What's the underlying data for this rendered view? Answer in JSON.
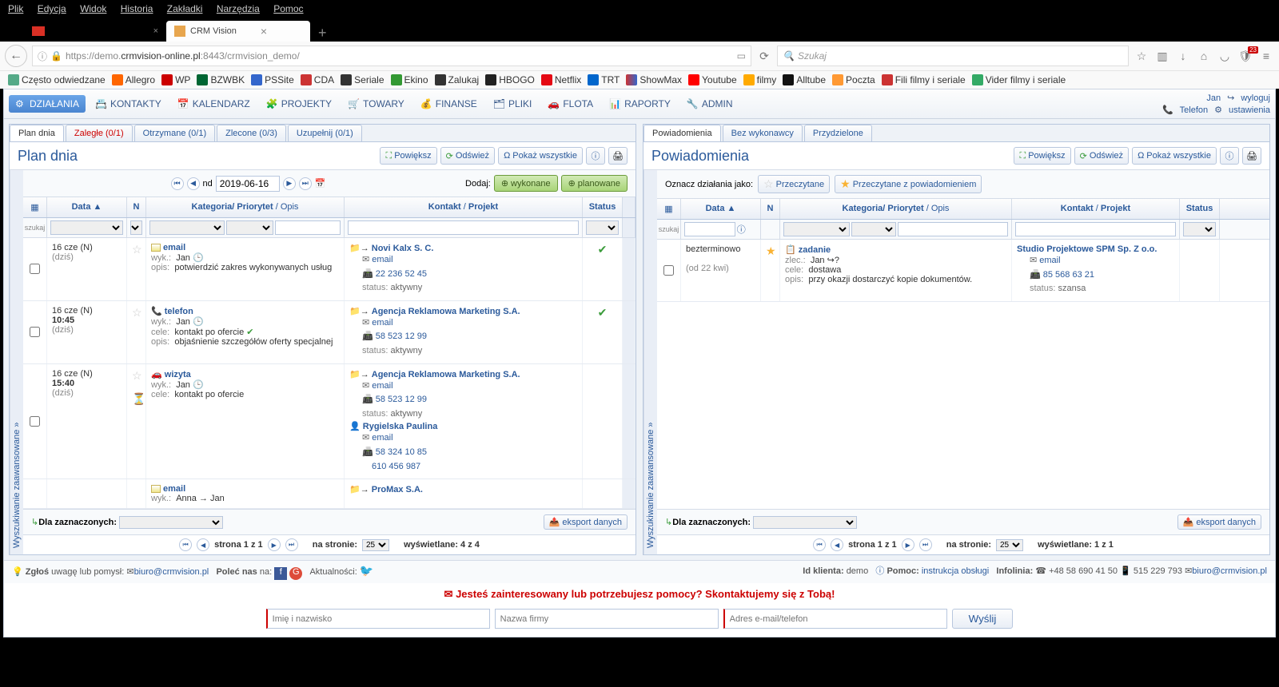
{
  "browser_menu": [
    "Plik",
    "Edycja",
    "Widok",
    "Historia",
    "Zakładki",
    "Narzędzia",
    "Pomoc"
  ],
  "tab_title": "CRM Vision",
  "url_text_1": "https://demo.",
  "url_text_2": "crmvision-online.pl",
  "url_text_3": ":8443/crmvision_demo/",
  "search_placeholder": "Szukaj",
  "shield_badge": "23",
  "bookmarks": [
    "Często odwiedzane",
    "Allegro",
    "WP",
    "BZWBK",
    "PSSite",
    "CDA",
    "Seriale",
    "Ekino",
    "Zalukaj",
    "HBOGO",
    "Netflix",
    "TRT",
    "ShowMax",
    "Youtube",
    "filmy",
    "Alltube",
    "Poczta",
    "Fili filmy i seriale",
    "Vider filmy i seriale"
  ],
  "nav": {
    "items": [
      "DZIAŁANIA",
      "KONTAKTY",
      "KALENDARZ",
      "PROJEKTY",
      "TOWARY",
      "FINANSE",
      "PLIKI",
      "FLOTA",
      "RAPORTY",
      "ADMIN"
    ],
    "user": "Jan",
    "logout": "wyloguj",
    "phone": "Telefon",
    "settings": "ustawienia"
  },
  "left": {
    "tabs": [
      "Plan dnia",
      "Zaległe (0/1)",
      "Otrzymane (0/1)",
      "Zlecone (0/3)",
      "Uzupełnij (0/1)"
    ],
    "title": "Plan dnia",
    "tools": {
      "expand": "Powiększ",
      "refresh": "Odśwież",
      "showall": "Pokaż wszystkie"
    },
    "adv_search": "Wyszukiwanie zaawansowane",
    "date_prefix": "nd",
    "date": "2019-06-16",
    "dodaj": "Dodaj:",
    "wykonane": "wykonane",
    "planowane": "planowane",
    "cols": {
      "date": "Data",
      "n": "N",
      "cat": "Kategoria/ Priorytet",
      "opis": "Opis",
      "kontakt": "Kontakt",
      "projekt": "Projekt",
      "status": "Status"
    },
    "search_lbl": "szukaj",
    "rows": [
      {
        "date": "16 cze (N)",
        "time": "",
        "today": "(dziś)",
        "type": "email",
        "type_ico": "mail",
        "wyk": "Jan",
        "cele": "",
        "opis": "potwierdzić zakres wykonywanych usług",
        "contact": "Novi Kalx S. C.",
        "c_email": "email",
        "c_phone": "22 236 52 45",
        "c_status": "aktywny",
        "status": "✔"
      },
      {
        "date": "16 cze (N)",
        "time": "10:45",
        "today": "(dziś)",
        "type": "telefon",
        "type_ico": "phone",
        "wyk": "Jan",
        "cele": "kontakt po ofercie",
        "cele_check": "✔",
        "opis": "objaśnienie szczegółów oferty specjalnej",
        "contact": "Agencja Reklamowa Marketing S.A.",
        "c_email": "email",
        "c_phone": "58 523 12 99",
        "c_status": "aktywny",
        "status": "✔"
      },
      {
        "date": "16 cze (N)",
        "time": "15:40",
        "today": "(dziś)",
        "type": "wizyta",
        "type_ico": "car",
        "wyk": "Jan",
        "cele": "kontakt po ofercie",
        "opis": "",
        "contact": "Agencja Reklamowa Marketing S.A.",
        "c_email": "email",
        "c_phone": "58 523 12 99",
        "c_status": "aktywny",
        "person": "Rygielska Paulina",
        "p_email": "email",
        "p_phone": "58 324 10 85",
        "p_mobile": "610 456 987",
        "hourglass": true
      },
      {
        "date": "",
        "type": "email",
        "type_ico": "mail",
        "wyk": "Anna",
        "wyk2": "Jan",
        "contact": "ProMax S.A."
      }
    ],
    "for_selected": "Dla zaznaczonych:",
    "export": "eksport danych",
    "pager": {
      "page": "strona 1 z 1",
      "per": "na stronie:",
      "per_val": "25",
      "shown": "wyświetlane: 4 z 4"
    }
  },
  "right": {
    "tabs": [
      "Powiadomienia",
      "Bez wykonawcy",
      "Przydzielone"
    ],
    "title": "Powiadomienia",
    "tools": {
      "expand": "Powiększ",
      "refresh": "Odśwież",
      "showall": "Pokaż wszystkie"
    },
    "mark_label": "Oznacz działania jako:",
    "mark1": "Przeczytane",
    "mark2": "Przeczytane z powiadomieniem",
    "adv_search": "Wyszukiwanie zaawansowane",
    "cols": {
      "date": "Data",
      "n": "N",
      "cat": "Kategoria/ Priorytet",
      "opis": "Opis",
      "kontakt": "Kontakt",
      "projekt": "Projekt",
      "status": "Status"
    },
    "search_lbl": "szukaj",
    "row": {
      "date1": "bezterminowo",
      "date2": "(od 22 kwi)",
      "type": "zadanie",
      "zlec_l": "zlec.:",
      "zlec": "Jan",
      "cele_l": "cele:",
      "cele": "dostawa",
      "opis_l": "opis:",
      "opis": "przy okazji dostarczyć kopie dokumentów.",
      "contact": "Studio Projektowe SPM Sp. Z o.o.",
      "c_email": "email",
      "c_phone": "85 568 63 21",
      "c_status_l": "status:",
      "c_status": "szansa"
    },
    "for_selected": "Dla zaznaczonych:",
    "export": "eksport danych",
    "pager": {
      "page": "strona 1 z 1",
      "per": "na stronie:",
      "per_val": "25",
      "shown": "wyświetlane: 1 z 1"
    }
  },
  "footer": {
    "report": "Zgłoś",
    "report_suffix": "uwagę lub pomysł:",
    "report_email": "biuro@crmvision.pl",
    "recommend": "Poleć nas",
    "recommend_suffix": "na:",
    "news": "Aktualności:",
    "client_l": "Id klienta:",
    "client": "demo",
    "help_l": "Pomoc:",
    "help": "instrukcja obsługi",
    "hotline_l": "Infolinia:",
    "hotline1": "+48 58 690 41 50",
    "hotline2": "515 229 793",
    "email": "biuro@crmvision.pl"
  },
  "cta": "Jesteś zainteresowany lub potrzebujesz pomocy? Skontaktujemy się z Tobą!",
  "form": {
    "name": "Imię i nazwisko",
    "company": "Nazwa firmy",
    "contact": "Adres e-mail/telefon",
    "send": "Wyślij"
  }
}
